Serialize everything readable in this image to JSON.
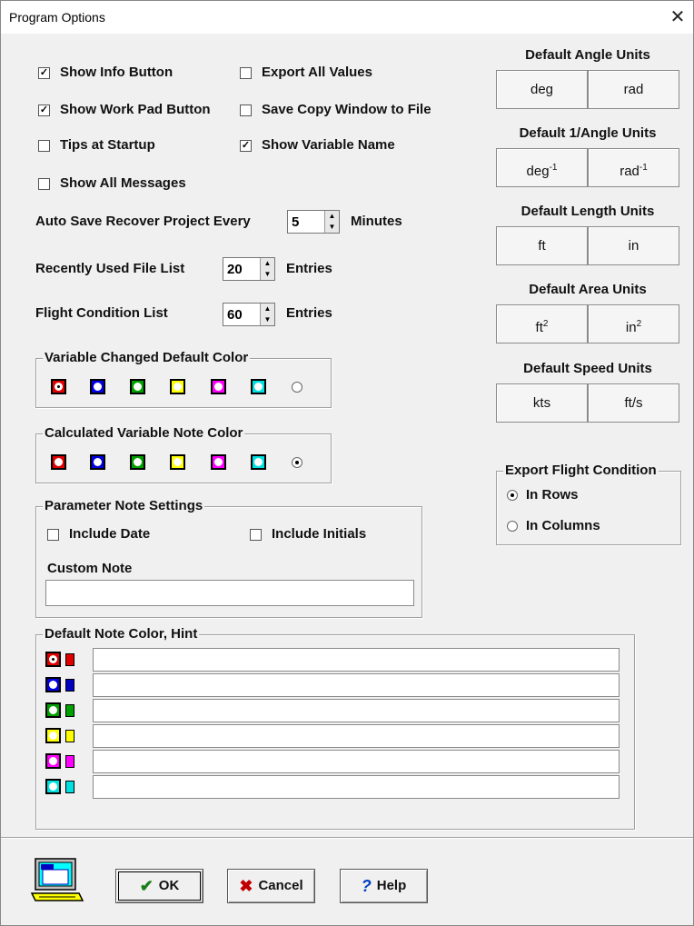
{
  "window": {
    "title": "Program Options",
    "close_glyph": "✕"
  },
  "options": {
    "show_info_button": {
      "label": "Show Info Button",
      "checked": true
    },
    "export_all_values": {
      "label": "Export All Values",
      "checked": false
    },
    "show_work_pad_button": {
      "label": "Show Work Pad Button",
      "checked": true
    },
    "save_copy_window": {
      "label": "Save Copy Window to File",
      "checked": false
    },
    "tips_at_startup": {
      "label": "Tips at Startup",
      "checked": false
    },
    "show_variable_name": {
      "label": "Show Variable Name",
      "checked": true
    },
    "show_all_messages": {
      "label": "Show All Messages",
      "checked": false
    }
  },
  "auto_save": {
    "label": "Auto Save Recover Project Every",
    "value": "5",
    "suffix": "Minutes"
  },
  "recent_files": {
    "label": "Recently Used File List",
    "value": "20",
    "suffix": "Entries"
  },
  "flight_condition_list": {
    "label": "Flight Condition List",
    "value": "60",
    "suffix": "Entries"
  },
  "variable_changed_color": {
    "title": "Variable Changed Default Color",
    "selected_index": 0
  },
  "calculated_note_color": {
    "title": "Calculated Variable Note Color",
    "selected_index": 6
  },
  "swatch_colors": [
    "#e00000",
    "#0000e0",
    "#00a000",
    "#ffff00",
    "#ff00ff",
    "#00e0e0"
  ],
  "parameter_note": {
    "title": "Parameter Note Settings",
    "include_date": {
      "label": "Include Date",
      "checked": false
    },
    "include_initials": {
      "label": "Include Initials",
      "checked": false
    },
    "custom_note_label": "Custom Note",
    "custom_note_value": ""
  },
  "default_note_color": {
    "title": "Default Note Color, Hint",
    "hints": [
      "",
      "",
      "",
      "",
      "",
      ""
    ]
  },
  "units": {
    "angle": {
      "title": "Default Angle Units",
      "a": "deg",
      "b": "rad"
    },
    "inv_angle": {
      "title": "Default 1/Angle Units",
      "a": "deg",
      "a_sup": "-1",
      "b": "rad",
      "b_sup": "-1"
    },
    "length": {
      "title": "Default Length Units",
      "a": "ft",
      "b": "in"
    },
    "area": {
      "title": "Default Area Units",
      "a": "ft",
      "a_sup": "2",
      "b": "in",
      "b_sup": "2"
    },
    "speed": {
      "title": "Default Speed Units",
      "a": "kts",
      "b": "ft/s"
    }
  },
  "export_flight_condition": {
    "title": "Export Flight Condition",
    "in_rows": {
      "label": "In Rows",
      "selected": true
    },
    "in_columns": {
      "label": "In Columns",
      "selected": false
    }
  },
  "buttons": {
    "ok": "OK",
    "cancel": "Cancel",
    "help": "Help"
  },
  "icons": {
    "ok": "check-icon",
    "cancel": "x-icon",
    "help": "question-icon",
    "computer": "computer-icon"
  }
}
